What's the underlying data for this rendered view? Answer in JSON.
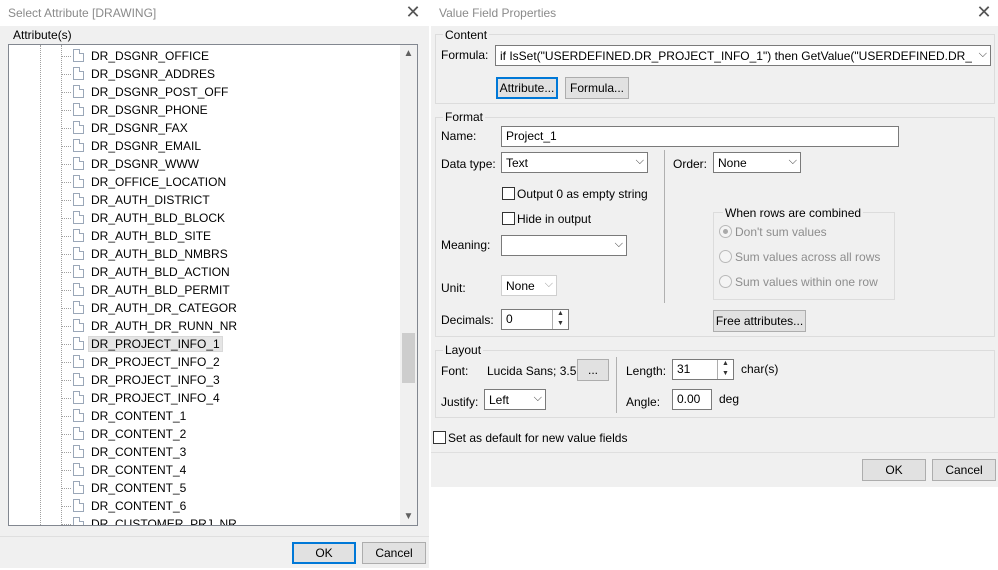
{
  "select_dialog": {
    "title": "Select Attribute [DRAWING]",
    "attributes_label": "Attribute(s)",
    "items": [
      "DR_DSGNR_OFFICE",
      "DR_DSGNR_ADDRES",
      "DR_DSGNR_POST_OFF",
      "DR_DSGNR_PHONE",
      "DR_DSGNR_FAX",
      "DR_DSGNR_EMAIL",
      "DR_DSGNR_WWW",
      "DR_OFFICE_LOCATION",
      "DR_AUTH_DISTRICT",
      "DR_AUTH_BLD_BLOCK",
      "DR_AUTH_BLD_SITE",
      "DR_AUTH_BLD_NMBRS",
      "DR_AUTH_BLD_ACTION",
      "DR_AUTH_BLD_PERMIT",
      "DR_AUTH_DR_CATEGOR",
      "DR_AUTH_DR_RUNN_NR",
      "DR_PROJECT_INFO_1",
      "DR_PROJECT_INFO_2",
      "DR_PROJECT_INFO_3",
      "DR_PROJECT_INFO_4",
      "DR_CONTENT_1",
      "DR_CONTENT_2",
      "DR_CONTENT_3",
      "DR_CONTENT_4",
      "DR_CONTENT_5",
      "DR_CONTENT_6",
      "DR_CUSTOMER_PRJ_NR"
    ],
    "selected_item": "DR_PROJECT_INFO_1",
    "ok_label": "OK",
    "cancel_label": "Cancel"
  },
  "value_dialog": {
    "title": "Value Field Properties",
    "content": {
      "group_label": "Content",
      "formula_label": "Formula:",
      "formula_value": "if IsSet(\"USERDEFINED.DR_PROJECT_INFO_1\") then    GetValue(\"USERDEFINED.DR_PROJEC",
      "attribute_button": "Attribute...",
      "formula_button": "Formula..."
    },
    "format": {
      "group_label": "Format",
      "name_label": "Name:",
      "name_value": "Project_1",
      "datatype_label": "Data type:",
      "datatype_value": "Text",
      "output0_label": "Output 0 as empty string",
      "hide_label": "Hide in output",
      "meaning_label": "Meaning:",
      "meaning_value": "",
      "unit_label": "Unit:",
      "unit_value": "None",
      "decimals_label": "Decimals:",
      "decimals_value": "0",
      "order_label": "Order:",
      "order_value": "None",
      "rows_group_label": "When rows are combined",
      "rows_options": [
        "Don't sum values",
        "Sum values across all rows",
        "Sum values within one row"
      ],
      "free_attributes_button": "Free attributes..."
    },
    "layout": {
      "group_label": "Layout",
      "font_label": "Font:",
      "font_value": "Lucida Sans; 3.5",
      "font_button": "...",
      "length_label": "Length:",
      "length_value": "31",
      "length_unit": "char(s)",
      "justify_label": "Justify:",
      "justify_value": "Left",
      "angle_label": "Angle:",
      "angle_value": "0.00",
      "angle_unit": "deg"
    },
    "default_label": "Set as default for new value fields",
    "ok_label": "OK",
    "cancel_label": "Cancel"
  }
}
